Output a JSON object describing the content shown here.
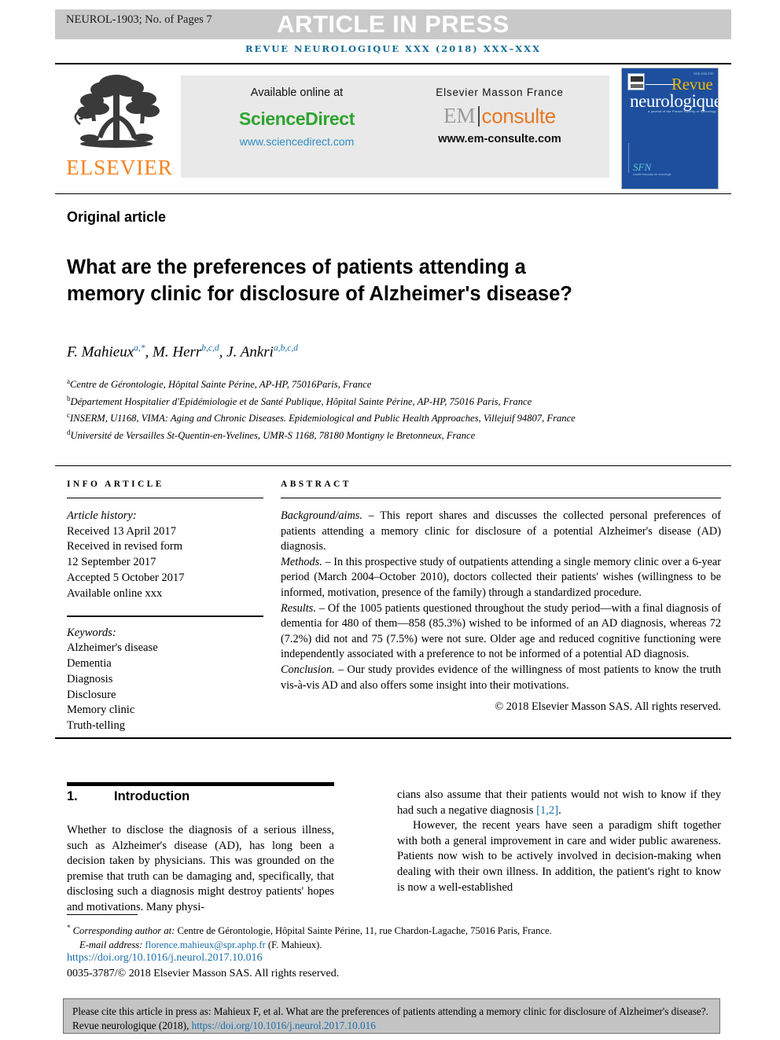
{
  "banner": {
    "code": "NEUROL-1903; No. of Pages 7",
    "article_in_press": "ARTICLE IN PRESS"
  },
  "running_head": "REVUE NEUROLOGIQUE XXX (2018) XXX–XXX",
  "logos": {
    "elsevier_wordmark": "ELSEVIER",
    "sciencedirect": {
      "available_at": "Available online at",
      "name": "ScienceDirect",
      "url": "www.sciencedirect.com"
    },
    "emconsulte": {
      "title": "Elsevier Masson France",
      "em": "EM",
      "consulte": "consulte",
      "url": "www.em-consulte.com"
    },
    "cover": {
      "revue": "Revue",
      "neurologique": "neurologique",
      "subtitle": "a journal of the French Society of Neurology",
      "society": "SFN",
      "society_sub": "société française de neurologie",
      "corner_code": "ISSN 0035-3787"
    }
  },
  "article": {
    "type": "Original article",
    "title": "What are the preferences of patients attending a memory clinic for disclosure of Alzheimer's disease?",
    "authors_html": "F. Mahieux<sup>a,*</sup>, M. Herr<sup>b,c,d</sup>, J. Ankri<sup>a,b,c,d</sup>",
    "affiliations": [
      {
        "marker": "a",
        "text": "Centre de Gérontologie, Hôpital Sainte Périne, AP-HP, 75016Paris, France"
      },
      {
        "marker": "b",
        "text": "Département Hospitalier d'Epidémiologie et de Santé Publique, Hôpital Sainte Périne, AP-HP, 75016 Paris, France"
      },
      {
        "marker": "c",
        "text": "INSERM, U1168, VIMA: Aging and Chronic Diseases. Epidemiological and Public Health Approaches, Villejuif 94807, France"
      },
      {
        "marker": "d",
        "text": "Université de Versailles St-Quentin-en-Yvelines, UMR-S 1168, 78180 Montigny le Bretonneux, France"
      }
    ]
  },
  "info_article": {
    "label": "INFO ARTICLE",
    "history_lead": "Article history:",
    "history": [
      "Received 13 April 2017",
      "Received in revised form",
      "12 September 2017",
      "Accepted 5 October 2017",
      "Available online xxx"
    ],
    "keywords_lead": "Keywords:",
    "keywords": [
      "Alzheimer's disease",
      "Dementia",
      "Diagnosis",
      "Disclosure",
      "Memory clinic",
      "Truth-telling"
    ]
  },
  "abstract": {
    "label": "ABSTRACT",
    "sections": [
      {
        "heading": "Background/aims",
        "text": " – This report shares and discusses the collected personal preferences of patients attending a memory clinic for disclosure of a potential Alzheimer's disease (AD) diagnosis."
      },
      {
        "heading": "Methods",
        "text": " – In this prospective study of outpatients attending a single memory clinic over a 6-year period (March 2004–October 2010), doctors collected their patients' wishes (willingness to be informed, motivation, presence of the family) through a standardized procedure."
      },
      {
        "heading": "Results",
        "text": " – Of the 1005 patients questioned throughout the study period—with a final diagnosis of dementia for 480 of them—858 (85.3%) wished to be informed of an AD diagnosis, whereas 72 (7.2%) did not and 75 (7.5%) were not sure. Older age and reduced cognitive functioning were independently associated with a preference to not be informed of a potential AD diagnosis."
      },
      {
        "heading": "Conclusion",
        "text": " – Our study provides evidence of the willingness of most patients to know the truth vis-à-vis AD and also offers some insight into their motivations."
      }
    ],
    "copyright": "© 2018 Elsevier Masson SAS. All rights reserved."
  },
  "body": {
    "section_number": "1.",
    "section_title": "Introduction",
    "left_column": "Whether to disclose the diagnosis of a serious illness, such as Alzheimer's disease (AD), has long been a decision taken by physicians. This was grounded on the premise that truth can be damaging and, specifically, that disclosing such a diagnosis might destroy patients' hopes and motivations. Many physi-",
    "right_paragraph_1_a": "cians also assume that their patients would not wish to know if they had such a negative diagnosis ",
    "right_paragraph_1_ref": "[1,2]",
    "right_paragraph_1_b": ".",
    "right_paragraph_2": "However, the recent years have seen a paradigm shift together with both a general improvement in care and wider public awareness. Patients now wish to be actively involved in decision-making when dealing with their own illness. In addition, the patient's right to know is now a well-established"
  },
  "footnotes": {
    "corresponding_marker": "*",
    "corresponding_lead": "Corresponding author at:",
    "corresponding_text": " Centre de Gérontologie, Hôpital Sainte Périne, 11, rue Chardon-Lagache, 75016 Paris, France.",
    "email_lead": "E-mail address:",
    "email": "florence.mahieux@spr.aphp.fr",
    "email_suffix": " (F. Mahieux).",
    "doi": "https://doi.org/10.1016/j.neurol.2017.10.016",
    "issn": "0035-3787/© 2018 Elsevier Masson SAS. All rights reserved."
  },
  "cite_box": {
    "text_a": "Please cite this article in press as: Mahieux F, et al. What are the preferences of patients attending a memory clinic for disclosure of Alzheimer's disease?. Revue neurologique (2018), ",
    "link": "https://doi.org/10.1016/j.neurol.2017.10.016"
  },
  "colors": {
    "journal_blue": "#0f6a96",
    "link_blue": "#1b6ea8",
    "elsevier_orange": "#f5821f",
    "sciencedirect_green": "#2ea42e",
    "emconsulte_orange": "#e87722",
    "cover_blue": "#1d4f9e",
    "banner_grey": "#c9c9c9"
  }
}
